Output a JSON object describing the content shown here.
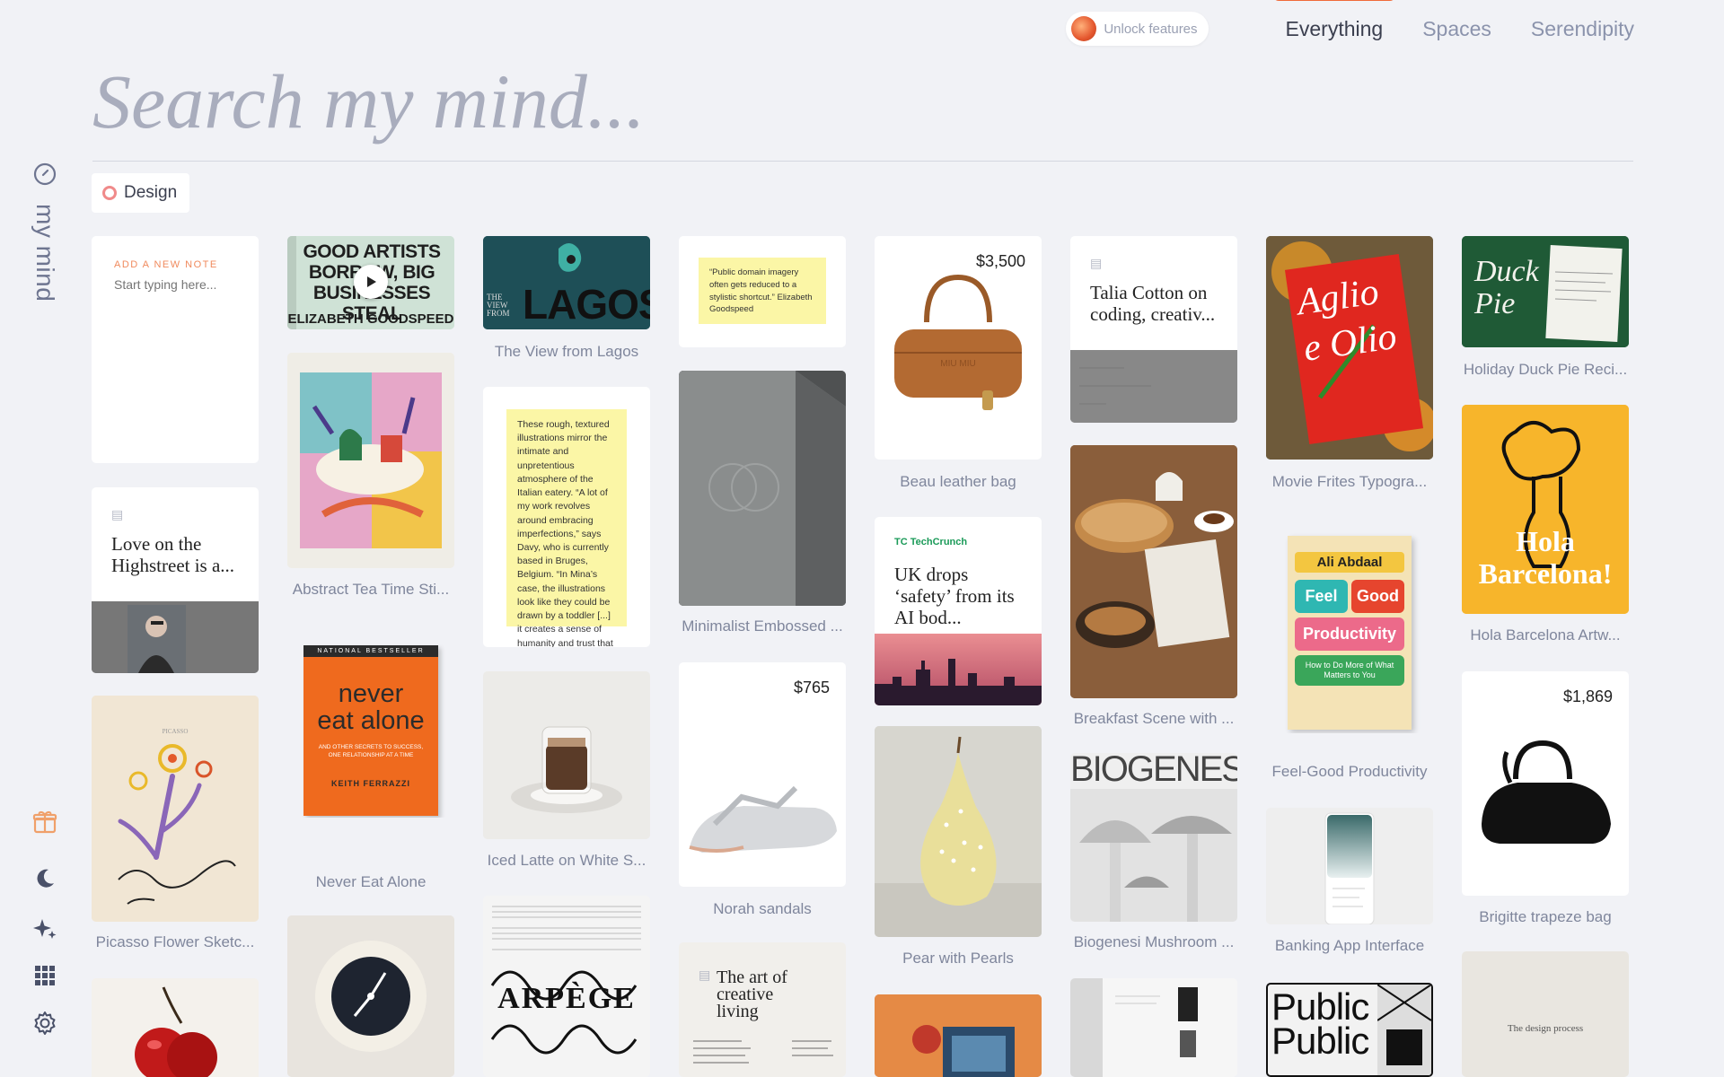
{
  "brand": {
    "name": "my mind"
  },
  "topnav": {
    "unlock_label": "Unlock features",
    "tabs": [
      "Everything",
      "Spaces",
      "Serendipity"
    ]
  },
  "search": {
    "placeholder": "Search my mind..."
  },
  "filter": {
    "label": "Design"
  },
  "note": {
    "label": "ADD A NEW NOTE",
    "placeholder": "Start typing here..."
  },
  "cards": {
    "love_highstreet": "Love on the Highstreet is a...",
    "talia": "Talia Cotton on coding, creativ...",
    "uk_drops": "UK drops ‘safety’ from its AI bod...",
    "techcrunch": "TechCrunch",
    "the_art": "The art of creative living",
    "design_process": "The design process",
    "good_artists": "GOOD ARTISTS BORROW, BIG BUSINESSES STEAL",
    "good_artists_author": "ELIZABETH GOODSPEED",
    "lagos": "LAGOS",
    "the_view_from": "THE VIEW FROM",
    "never_eat": "never eat alone",
    "never_eat_top": "NATIONAL BESTSELLER",
    "never_eat_sub": "AND OTHER SECRETS TO SUCCESS, ONE RELATIONSHIP AT A TIME",
    "never_eat_author": "KEITH FERRAZZI",
    "feel_good_author": "Ali Abdaal",
    "feel": "Feel",
    "good": "Good",
    "productivity": "Productivity",
    "feel_good_sub": "How to Do More of What Matters to You",
    "hola": "Hola Barcelona!",
    "duck_pie": "Duck Pie",
    "aglio": "Aglio e Olio",
    "biogenesi": "BIOGENESI",
    "public": "Public",
    "picasso": "PICASSO",
    "arpege": "ARPÈGE",
    "quote1": "“Public domain imagery often gets reduced to a stylistic shortcut.” Elizabeth Goodspeed",
    "quote2": "These rough, textured illustrations mirror the intimate and unpretentious atmosphere of the Italian eatery. “A lot of my work revolves around embracing imperfections,” says Davy, who is currently based in Bruges, Belgium. “In Mina’s case, the illustrations look like they could be drawn by a toddler [...] it creates a sense of humanity and trust that really resonates in the hospitality industry.”"
  },
  "captions": {
    "picasso": "Picasso Flower Sketc...",
    "abstract": "Abstract Tea Time Sti...",
    "never_eat": "Never Eat Alone",
    "lagos": "The View from Lagos",
    "latte": "Iced Latte on White S...",
    "embossed": "Minimalist Embossed ...",
    "norah": "Norah sandals",
    "beau": "Beau leather bag",
    "pear": "Pear with Pearls",
    "breakfast": "Breakfast Scene with ...",
    "biogenesi": "Biogenesi Mushroom ...",
    "movie": "Movie Frites Typogra...",
    "feel_good": "Feel-Good Productivity",
    "banking": "Banking App Interface",
    "duck": "Holiday Duck Pie Reci...",
    "hola": "Hola Barcelona Artw...",
    "brigitte": "Brigitte trapeze bag"
  },
  "prices": {
    "beau": "$3,500",
    "norah": "$765",
    "brigitte": "$1,869"
  },
  "colors": {
    "accent": "#f06a3a",
    "background": "#f1f2f6"
  }
}
